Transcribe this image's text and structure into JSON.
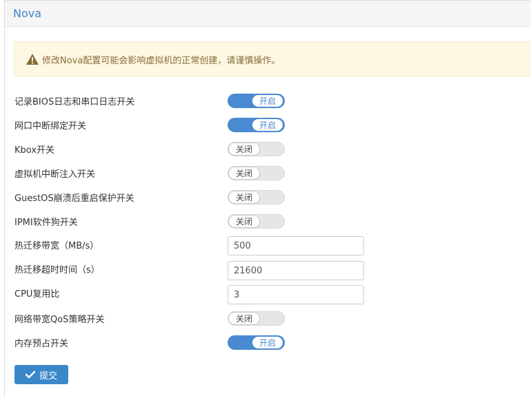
{
  "panel": {
    "title": "Nova"
  },
  "alert": {
    "text": "修改Nova配置可能会影响虚拟机的正常创建，请谨慎操作。",
    "icon": "warning-icon",
    "color": "#8a6d3b"
  },
  "settings": [
    {
      "label": "记录BIOS日志和串口日志开关",
      "type": "toggle",
      "state": "on",
      "text": "开启"
    },
    {
      "label": "网口中断绑定开关",
      "type": "toggle",
      "state": "on",
      "text": "开启"
    },
    {
      "label": "Kbox开关",
      "type": "toggle",
      "state": "off",
      "text": "关闭"
    },
    {
      "label": "虚拟机中断注入开关",
      "type": "toggle",
      "state": "off",
      "text": "关闭"
    },
    {
      "label": "GuestOS崩溃后重启保护开关",
      "type": "toggle",
      "state": "off",
      "text": "关闭"
    },
    {
      "label": "IPMI软件狗开关",
      "type": "toggle",
      "state": "off",
      "text": "关闭"
    },
    {
      "label": "热迁移带宽（MB/s）",
      "type": "input",
      "value": "500"
    },
    {
      "label": "热迁移超时时间（s）",
      "type": "input",
      "value": "21600"
    },
    {
      "label": "CPU复用比",
      "type": "input",
      "value": "3"
    },
    {
      "label": "网络带宽QoS策略开关",
      "type": "toggle",
      "state": "off",
      "text": "关闭"
    },
    {
      "label": "内存预占开关",
      "type": "toggle",
      "state": "on",
      "text": "开启"
    }
  ],
  "submit": {
    "label": "提交",
    "icon": "check-icon"
  },
  "colors": {
    "accent": "#3a87c9",
    "toggle_on": "#4a8ad0",
    "alert_bg": "#fcf8e3"
  }
}
